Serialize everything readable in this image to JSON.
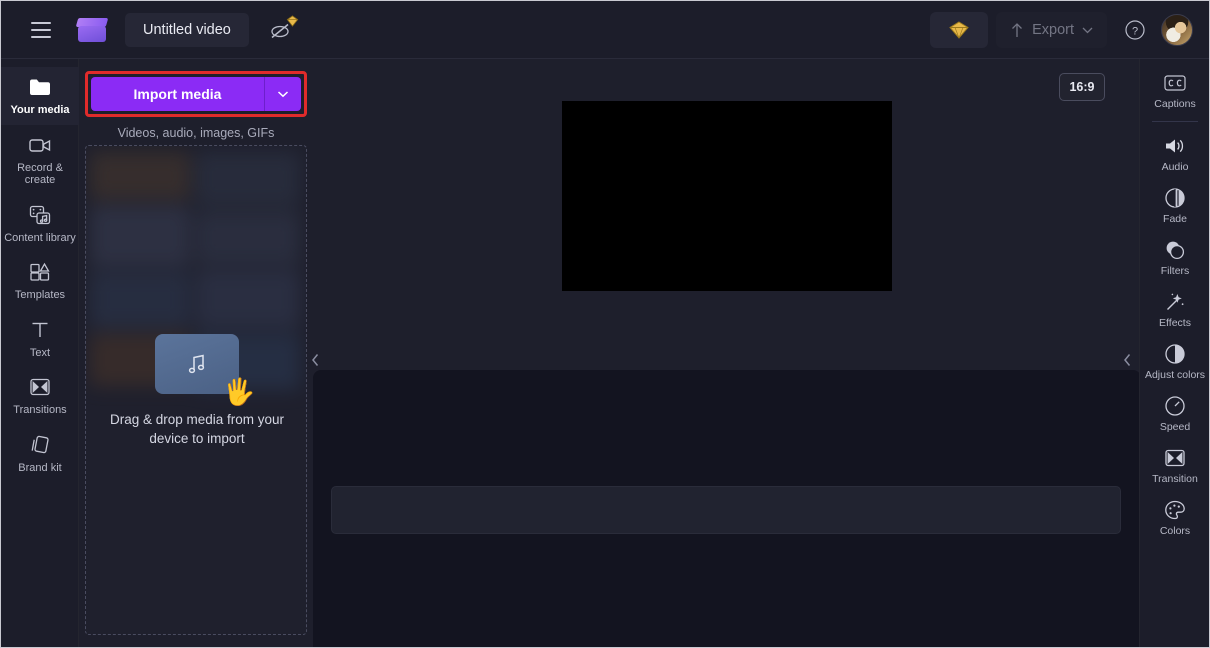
{
  "app": {
    "title": "Untitled video",
    "accent": "#8b2bf5",
    "highlight": "#e02b2b",
    "background": "#1b1c28"
  },
  "topbar": {
    "menu_icon": "hamburger-icon",
    "logo_icon": "clapperboard-logo",
    "title_value": "Untitled video",
    "title_placeholder": "Untitled video",
    "autosave_icon": "autosave-off-icon",
    "premium_icon": "diamond-icon",
    "export_label": "Export",
    "export_icon": "upload-arrow-icon",
    "export_caret_icon": "chevron-down-icon",
    "help_icon": "question-circle-icon",
    "avatar_icon": "user-avatar"
  },
  "left_rail": {
    "items": [
      {
        "label": "Your media",
        "icon": "folder-icon",
        "active": true
      },
      {
        "label": "Record & create",
        "icon": "video-camera-icon",
        "active": false
      },
      {
        "label": "Content library",
        "icon": "content-library-icon",
        "active": false
      },
      {
        "label": "Templates",
        "icon": "templates-grid-icon",
        "active": false
      },
      {
        "label": "Text",
        "icon": "text-t-icon",
        "active": false
      },
      {
        "label": "Transitions",
        "icon": "transitions-icon",
        "active": false
      },
      {
        "label": "Brand kit",
        "icon": "brand-kit-icon",
        "active": false
      }
    ]
  },
  "media_panel": {
    "import_label": "Import media",
    "import_caret_icon": "chevron-down-icon",
    "import_subtitle": "Videos, audio, images, GIFs",
    "dropzone_icon": "music-note-card-icon",
    "dropzone_hand_icon": "drag-hand-icon",
    "dropzone_text": "Drag & drop media from your device to import"
  },
  "stage": {
    "aspect_ratio": "16:9",
    "collapse_left_icon": "chevron-left-icon",
    "collapse_right_icon": "chevron-left-icon"
  },
  "right_rail": {
    "items": [
      {
        "label": "Captions",
        "icon": "captions-cc-icon",
        "divider_after": true
      },
      {
        "label": "Audio",
        "icon": "speaker-icon",
        "divider_after": false
      },
      {
        "label": "Fade",
        "icon": "fade-circle-icon",
        "divider_after": false
      },
      {
        "label": "Filters",
        "icon": "filters-circles-icon",
        "divider_after": false
      },
      {
        "label": "Effects",
        "icon": "magic-wand-icon",
        "divider_after": false
      },
      {
        "label": "Adjust colors",
        "icon": "contrast-circle-icon",
        "divider_after": false
      },
      {
        "label": "Speed",
        "icon": "speedometer-icon",
        "divider_after": false
      },
      {
        "label": "Transition",
        "icon": "transition-icon",
        "divider_after": false
      },
      {
        "label": "Colors",
        "icon": "palette-icon",
        "divider_after": false
      }
    ]
  }
}
